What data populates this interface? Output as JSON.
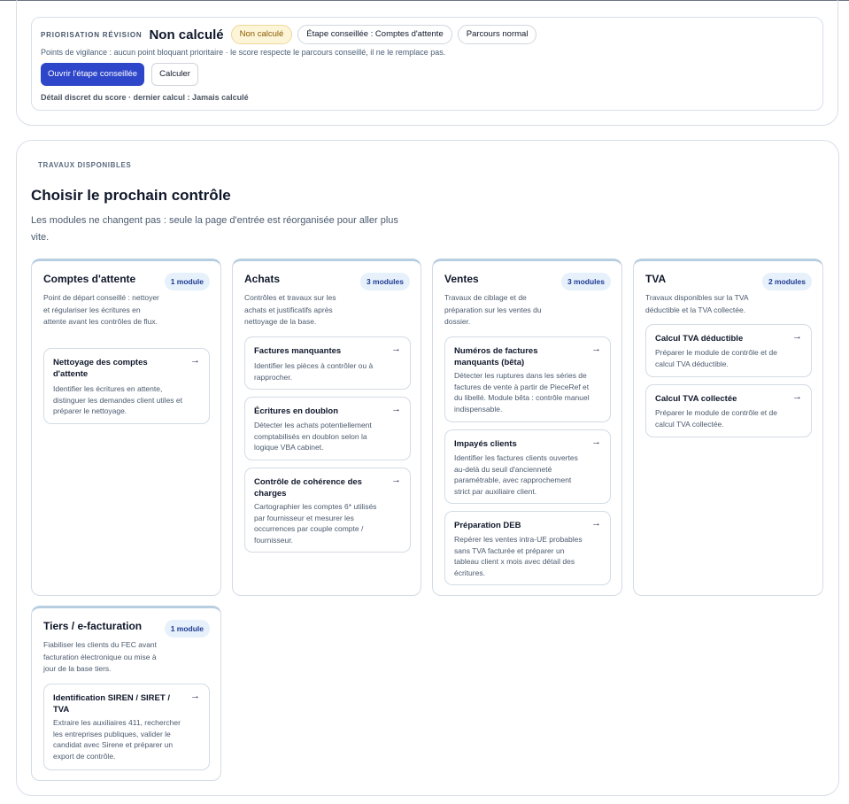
{
  "priorisation": {
    "kicker": "PRIORISATION RÉVISION",
    "score": "Non calculé",
    "status_pill": "Non calculé",
    "step_pill": "Étape conseillée : Comptes d'attente",
    "path_pill": "Parcours normal",
    "vigilance": "Points de vigilance : aucun point bloquant prioritaire · le score respecte le parcours conseillé, il ne le remplace pas.",
    "open_button": "Ouvrir l'étape conseillée",
    "compute_button": "Calculer",
    "detail": "Détail discret du score · dernier calcul : Jamais calculé"
  },
  "travaux": {
    "kicker": "TRAVAUX DISPONIBLES",
    "title": "Choisir le prochain contrôle",
    "subtitle": "Les modules ne changent pas : seule la page d'entrée est réorganisée pour aller plus vite."
  },
  "categories": [
    {
      "title": "Comptes d'attente",
      "badge": "1 module",
      "description": "Point de départ conseillé : nettoyer et régulariser les écritures en attente avant les contrôles de flux.",
      "modules": [
        {
          "title": "Nettoyage des comptes d'attente",
          "arrow": "→",
          "description": "Identifier les écritures en attente, distinguer les demandes client utiles et préparer le nettoyage."
        }
      ]
    },
    {
      "title": "Achats",
      "badge": "3 modules",
      "description": "Contrôles et travaux sur les achats et justificatifs après nettoyage de la base.",
      "modules": [
        {
          "title": "Factures manquantes",
          "arrow": "→",
          "description": "Identifier les pièces à contrôler ou à rapprocher."
        },
        {
          "title": "Écritures en doublon",
          "arrow": "→",
          "description": "Détecter les achats potentiellement comptabilisés en doublon selon la logique VBA cabinet."
        },
        {
          "title": "Contrôle de cohérence des charges",
          "arrow": "→",
          "description": "Cartographier les comptes 6* utilisés par fournisseur et mesurer les occurrences par couple compte / fournisseur."
        }
      ]
    },
    {
      "title": "Ventes",
      "badge": "3 modules",
      "description": "Travaux de ciblage et de préparation sur les ventes du dossier.",
      "modules": [
        {
          "title": "Numéros de factures manquants (bêta)",
          "arrow": "→",
          "description": "Détecter les ruptures dans les séries de factures de vente à partir de PieceRef et du libellé. Module bêta : contrôle manuel indispensable."
        },
        {
          "title": "Impayés clients",
          "arrow": "→",
          "description": "Identifier les factures clients ouvertes au-delà du seuil d'ancienneté paramétrable, avec rapprochement strict par auxiliaire client."
        },
        {
          "title": "Préparation DEB",
          "arrow": "→",
          "description": "Repérer les ventes intra-UE probables sans TVA facturée et préparer un tableau client x mois avec détail des écritures."
        }
      ]
    },
    {
      "title": "TVA",
      "badge": "2 modules",
      "description": "Travaux disponibles sur la TVA déductible et la TVA collectée.",
      "modules": [
        {
          "title": "Calcul TVA déductible",
          "arrow": "→",
          "description": "Préparer le module de contrôle et de calcul TVA déductible."
        },
        {
          "title": "Calcul TVA collectée",
          "arrow": "→",
          "description": "Préparer le module de contrôle et de calcul TVA collectée."
        }
      ]
    },
    {
      "title": "Tiers / e-facturation",
      "badge": "1 module",
      "description": "Fiabiliser les clients du FEC avant facturation électronique ou mise à jour de la base tiers.",
      "modules": [
        {
          "title": "Identification SIREN / SIRET / TVA",
          "arrow": "→",
          "description": "Extraire les auxiliaires 411, rechercher les entreprises publiques, valider le candidat avec Sirene et préparer un export de contrôle."
        }
      ]
    }
  ]
}
